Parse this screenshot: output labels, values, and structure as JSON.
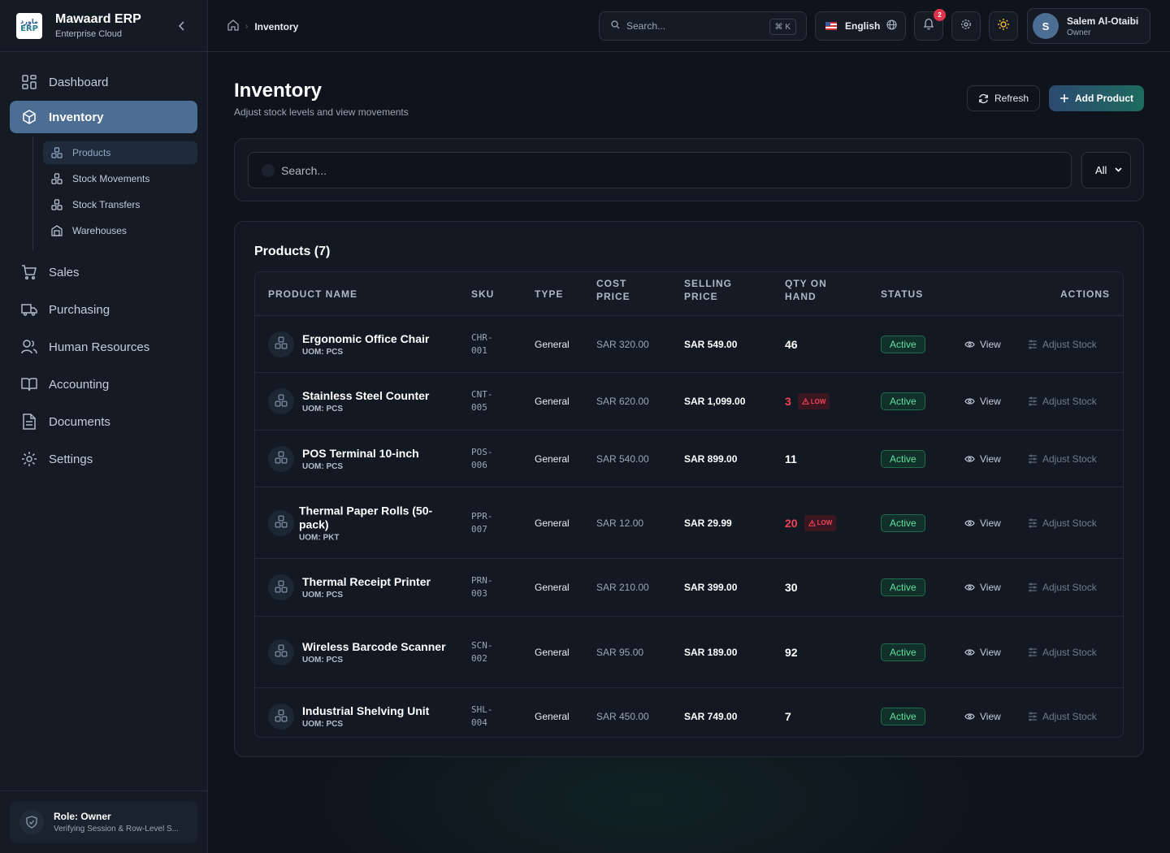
{
  "app": {
    "logo_line1": "ماورد",
    "logo_line2": "ERP",
    "name": "Mawaard ERP",
    "subtitle": "Enterprise Cloud"
  },
  "sidebar": {
    "items": [
      {
        "label": "Dashboard",
        "icon": "grid-icon"
      },
      {
        "label": "Inventory",
        "icon": "box-icon",
        "active": true
      },
      {
        "label": "Sales",
        "icon": "cart-icon"
      },
      {
        "label": "Purchasing",
        "icon": "truck-icon"
      },
      {
        "label": "Human Resources",
        "icon": "users-icon"
      },
      {
        "label": "Accounting",
        "icon": "book-icon"
      },
      {
        "label": "Documents",
        "icon": "document-icon"
      },
      {
        "label": "Settings",
        "icon": "gear-icon"
      }
    ],
    "subitems": [
      {
        "label": "Products",
        "icon": "boxes-icon",
        "active": true
      },
      {
        "label": "Stock Movements",
        "icon": "boxes-icon"
      },
      {
        "label": "Stock Transfers",
        "icon": "boxes-icon"
      },
      {
        "label": "Warehouses",
        "icon": "warehouse-icon"
      }
    ],
    "role_title": "Role: Owner",
    "role_sub": "Verifying Session & Row-Level S..."
  },
  "topbar": {
    "breadcrumb": "Inventory",
    "search_placeholder": "Search...",
    "search_shortcut": "⌘ K",
    "language": "English",
    "notification_count": "2",
    "user_initial": "S",
    "user_name": "Salem Al-Otaibi",
    "user_role": "Owner"
  },
  "page": {
    "title": "Inventory",
    "subtitle": "Adjust stock levels and view movements",
    "refresh_label": "Refresh",
    "add_label": "Add Product",
    "filter_placeholder": "Search...",
    "filter_value": "All",
    "table_title": "Products (7)"
  },
  "table": {
    "headers": {
      "name": "PRODUCT NAME",
      "sku": "SKU",
      "type": "TYPE",
      "cost": "COST PRICE",
      "sell": "SELLING PRICE",
      "qty": "QTY ON HAND",
      "status": "STATUS",
      "actions": "ACTIONS"
    },
    "view_label": "View",
    "adjust_label": "Adjust Stock",
    "low_label": "LOW",
    "rows": [
      {
        "name": "Ergonomic Office Chair",
        "uom": "UOM: PCS",
        "sku1": "CHR-",
        "sku2": "001",
        "type": "General",
        "cost": "SAR 320.00",
        "sell": "SAR 549.00",
        "qty": "46",
        "low": false,
        "status": "Active"
      },
      {
        "name": "Stainless Steel Counter",
        "uom": "UOM: PCS",
        "sku1": "CNT-",
        "sku2": "005",
        "type": "General",
        "cost": "SAR 620.00",
        "sell": "SAR 1,099.00",
        "qty": "3",
        "low": true,
        "status": "Active"
      },
      {
        "name": "POS Terminal 10-inch",
        "uom": "UOM: PCS",
        "sku1": "POS-",
        "sku2": "006",
        "type": "General",
        "cost": "SAR 540.00",
        "sell": "SAR 899.00",
        "qty": "11",
        "low": false,
        "status": "Active"
      },
      {
        "name": "Thermal Paper Rolls (50-pack)",
        "uom": "UOM: PKT",
        "sku1": "PPR-",
        "sku2": "007",
        "type": "General",
        "cost": "SAR 12.00",
        "sell": "SAR 29.99",
        "qty": "20",
        "low": true,
        "status": "Active"
      },
      {
        "name": "Thermal Receipt Printer",
        "uom": "UOM: PCS",
        "sku1": "PRN-",
        "sku2": "003",
        "type": "General",
        "cost": "SAR 210.00",
        "sell": "SAR 399.00",
        "qty": "30",
        "low": false,
        "status": "Active"
      },
      {
        "name": "Wireless Barcode Scanner",
        "uom": "UOM: PCS",
        "sku1": "SCN-",
        "sku2": "002",
        "type": "General",
        "cost": "SAR 95.00",
        "sell": "SAR 189.00",
        "qty": "92",
        "low": false,
        "status": "Active"
      },
      {
        "name": "Industrial Shelving Unit",
        "uom": "UOM: PCS",
        "sku1": "SHL-",
        "sku2": "004",
        "type": "General",
        "cost": "SAR 450.00",
        "sell": "SAR 749.00",
        "qty": "7",
        "low": false,
        "status": "Active"
      }
    ]
  },
  "colors": {
    "accent": "#4b6e92",
    "success": "#5ee0a0",
    "danger": "#f0435a"
  }
}
